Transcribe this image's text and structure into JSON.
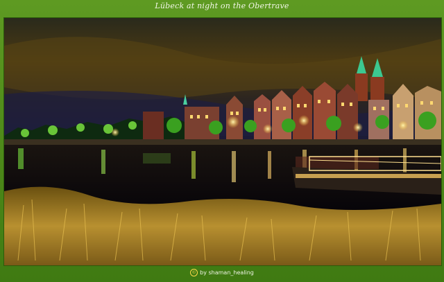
{
  "title": "Lübeck at night on the Obertrave",
  "credit": {
    "icon": "copyright-icon",
    "symbol": "©",
    "text": "by shaman_healing"
  },
  "colors": {
    "frame": "#4a8a1a",
    "sky": "#3a2e10",
    "water": "#07050c",
    "grass": "#b08a2a"
  }
}
